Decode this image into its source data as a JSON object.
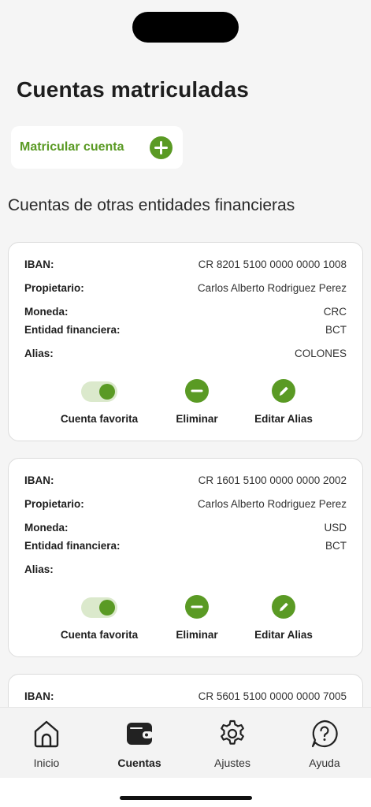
{
  "page": {
    "title": "Cuentas matriculadas",
    "enroll_label": "Matricular cuenta",
    "section_title": "Cuentas de otras entidades financieras"
  },
  "labels": {
    "iban": "IBAN:",
    "owner": "Propietario:",
    "currency": "Moneda:",
    "entity": "Entidad financiera:",
    "alias": "Alias:",
    "favorite": "Cuenta favorita",
    "delete": "Eliminar",
    "edit_alias": "Editar Alias"
  },
  "accounts": [
    {
      "iban": "CR 8201 5100 0000 0000 1008",
      "owner": "Carlos Alberto Rodriguez Perez",
      "currency": "CRC",
      "entity": "BCT",
      "alias": "COLONES",
      "favorite": true
    },
    {
      "iban": "CR 1601 5100 0000 0000 2002",
      "owner": "Carlos Alberto Rodriguez Perez",
      "currency": "USD",
      "entity": "BCT",
      "alias": "",
      "favorite": true
    },
    {
      "iban": "CR 5601 5100 0000 0000 7005"
    }
  ],
  "tabbar": {
    "items": [
      {
        "label": "Inicio",
        "icon": "home-icon"
      },
      {
        "label": "Cuentas",
        "icon": "wallet-icon",
        "active": true
      },
      {
        "label": "Ajustes",
        "icon": "gear-icon"
      },
      {
        "label": "Ayuda",
        "icon": "help-icon"
      }
    ]
  },
  "colors": {
    "accent": "#5a9a24",
    "background": "#f5f5f5"
  }
}
